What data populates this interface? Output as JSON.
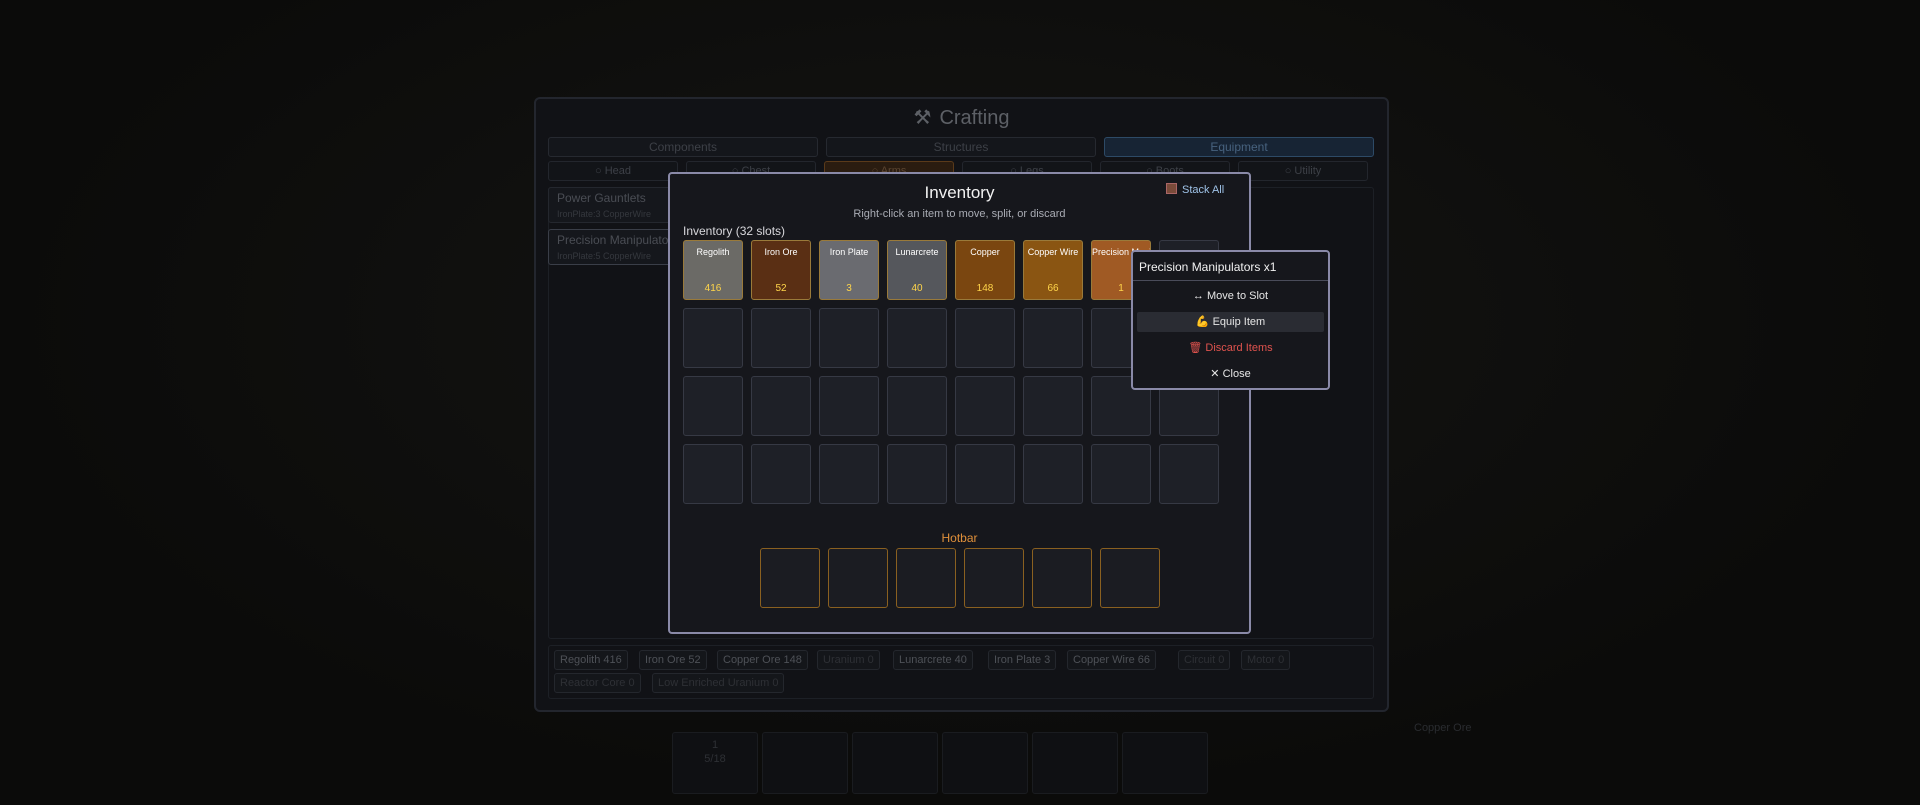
{
  "crafting": {
    "title": "Crafting",
    "category_tabs": [
      "Components",
      "Structures",
      "Equipment"
    ],
    "sub_tabs": [
      "Head",
      "Chest",
      "Arms",
      "Legs",
      "Boots",
      "Utility"
    ],
    "recipes": [
      {
        "name": "Power Gauntlets",
        "requires": "IronPlate:3  CopperWire"
      },
      {
        "name": "Precision Manipulators",
        "requires": "IronPlate:5  CopperWire"
      }
    ],
    "resources": [
      {
        "label": "Regolith  416"
      },
      {
        "label": "Iron Ore  52"
      },
      {
        "label": "Copper Ore  148"
      },
      {
        "label": "Uranium  0"
      },
      {
        "label": "Lunarcrete  40"
      },
      {
        "label": "Iron Plate  3"
      },
      {
        "label": "Copper Wire  66"
      },
      {
        "label": "Circuit  0"
      },
      {
        "label": "Motor  0"
      },
      {
        "label": "Reactor Core  0"
      },
      {
        "label": "Low Enriched Uranium  0"
      }
    ]
  },
  "background_hotbar": {
    "first_count": "1",
    "first_sub": "5/18",
    "right_label": "Copper Ore"
  },
  "inventory": {
    "title": "Inventory",
    "subtitle": "Right-click an item to move, split, or discard",
    "stack_all": "Stack All",
    "slot_count_label": "Inventory (32 slots)",
    "items": [
      {
        "name": "Regolith",
        "count": "416",
        "color": "#6b6a66"
      },
      {
        "name": "Iron Ore",
        "count": "52",
        "color": "#5a2f14"
      },
      {
        "name": "Iron Plate",
        "count": "3",
        "color": "#6a6b70"
      },
      {
        "name": "Lunarcrete",
        "count": "40",
        "color": "#55575c"
      },
      {
        "name": "Copper",
        "count": "148",
        "color": "#7a4610"
      },
      {
        "name": "Copper Wire",
        "count": "66",
        "color": "#8a5512"
      },
      {
        "name": "Precision Manipulators",
        "count": "1",
        "color": "#a05a24"
      }
    ],
    "hotbar_label": "Hotbar"
  },
  "context_menu": {
    "title": "Precision Manipulators x1",
    "move": "↔ Move to Slot",
    "equip": "Equip Item",
    "discard": "Discard Items",
    "close": "✕ Close"
  }
}
